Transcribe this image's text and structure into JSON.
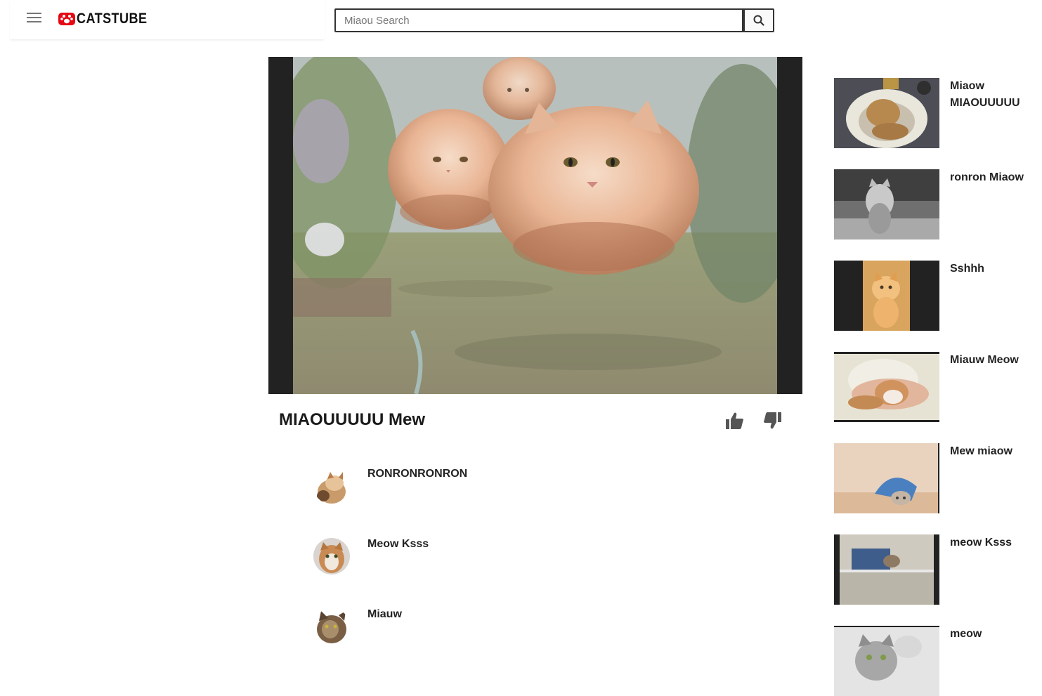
{
  "app": {
    "logo_text": "CATSTUBE"
  },
  "search": {
    "placeholder": "Miaou Search",
    "value": ""
  },
  "video": {
    "title": "MIAOUUUUU Mew"
  },
  "comments": [
    {
      "author": "RONRONRONRON"
    },
    {
      "author": "Meow Ksss"
    },
    {
      "author": "Miauw"
    }
  ],
  "recommended": [
    {
      "title": "Miaow MIAOUUUUU"
    },
    {
      "title": "ronron Miaow"
    },
    {
      "title": "Sshhh"
    },
    {
      "title": "Miauw Meow"
    },
    {
      "title": "Mew miaow"
    },
    {
      "title": "meow Ksss"
    },
    {
      "title": "meow"
    }
  ],
  "colors": {
    "brand": "#e50914",
    "player_bg": "#222222",
    "text": "#212121"
  },
  "icons": {
    "menu": "hamburger-icon",
    "search": "magnifier-icon",
    "like": "thumbs-up-icon",
    "dislike": "thumbs-down-icon"
  }
}
